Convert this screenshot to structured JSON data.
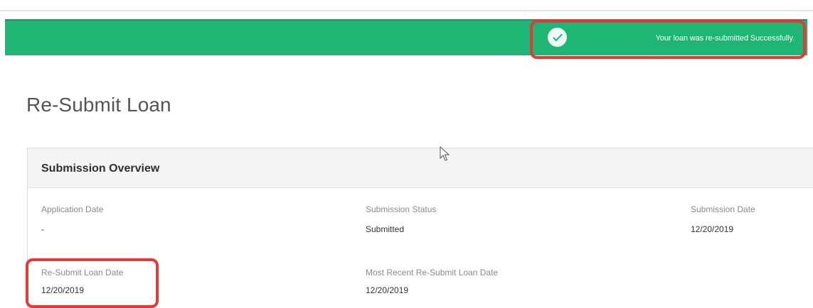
{
  "notification": {
    "message": "Your loan was re-submitted Successfully.",
    "icon": "check-circle-icon",
    "color": "#1fb574"
  },
  "page": {
    "title": "Re-Submit Loan"
  },
  "overview": {
    "title": "Submission Overview",
    "fields": {
      "application_date": {
        "label": "Application Date",
        "value": "-"
      },
      "submission_status": {
        "label": "Submission Status",
        "value": "Submitted"
      },
      "submission_date": {
        "label": "Submission Date",
        "value": "12/20/2019"
      },
      "resubmit_loan_date": {
        "label": "Re-Submit Loan Date",
        "value": "12/20/2019"
      },
      "most_recent_resubmit_date": {
        "label": "Most Recent Re-Submit Loan Date",
        "value": "12/20/2019"
      }
    }
  },
  "annotations": {
    "highlight_color": "#e53935"
  }
}
